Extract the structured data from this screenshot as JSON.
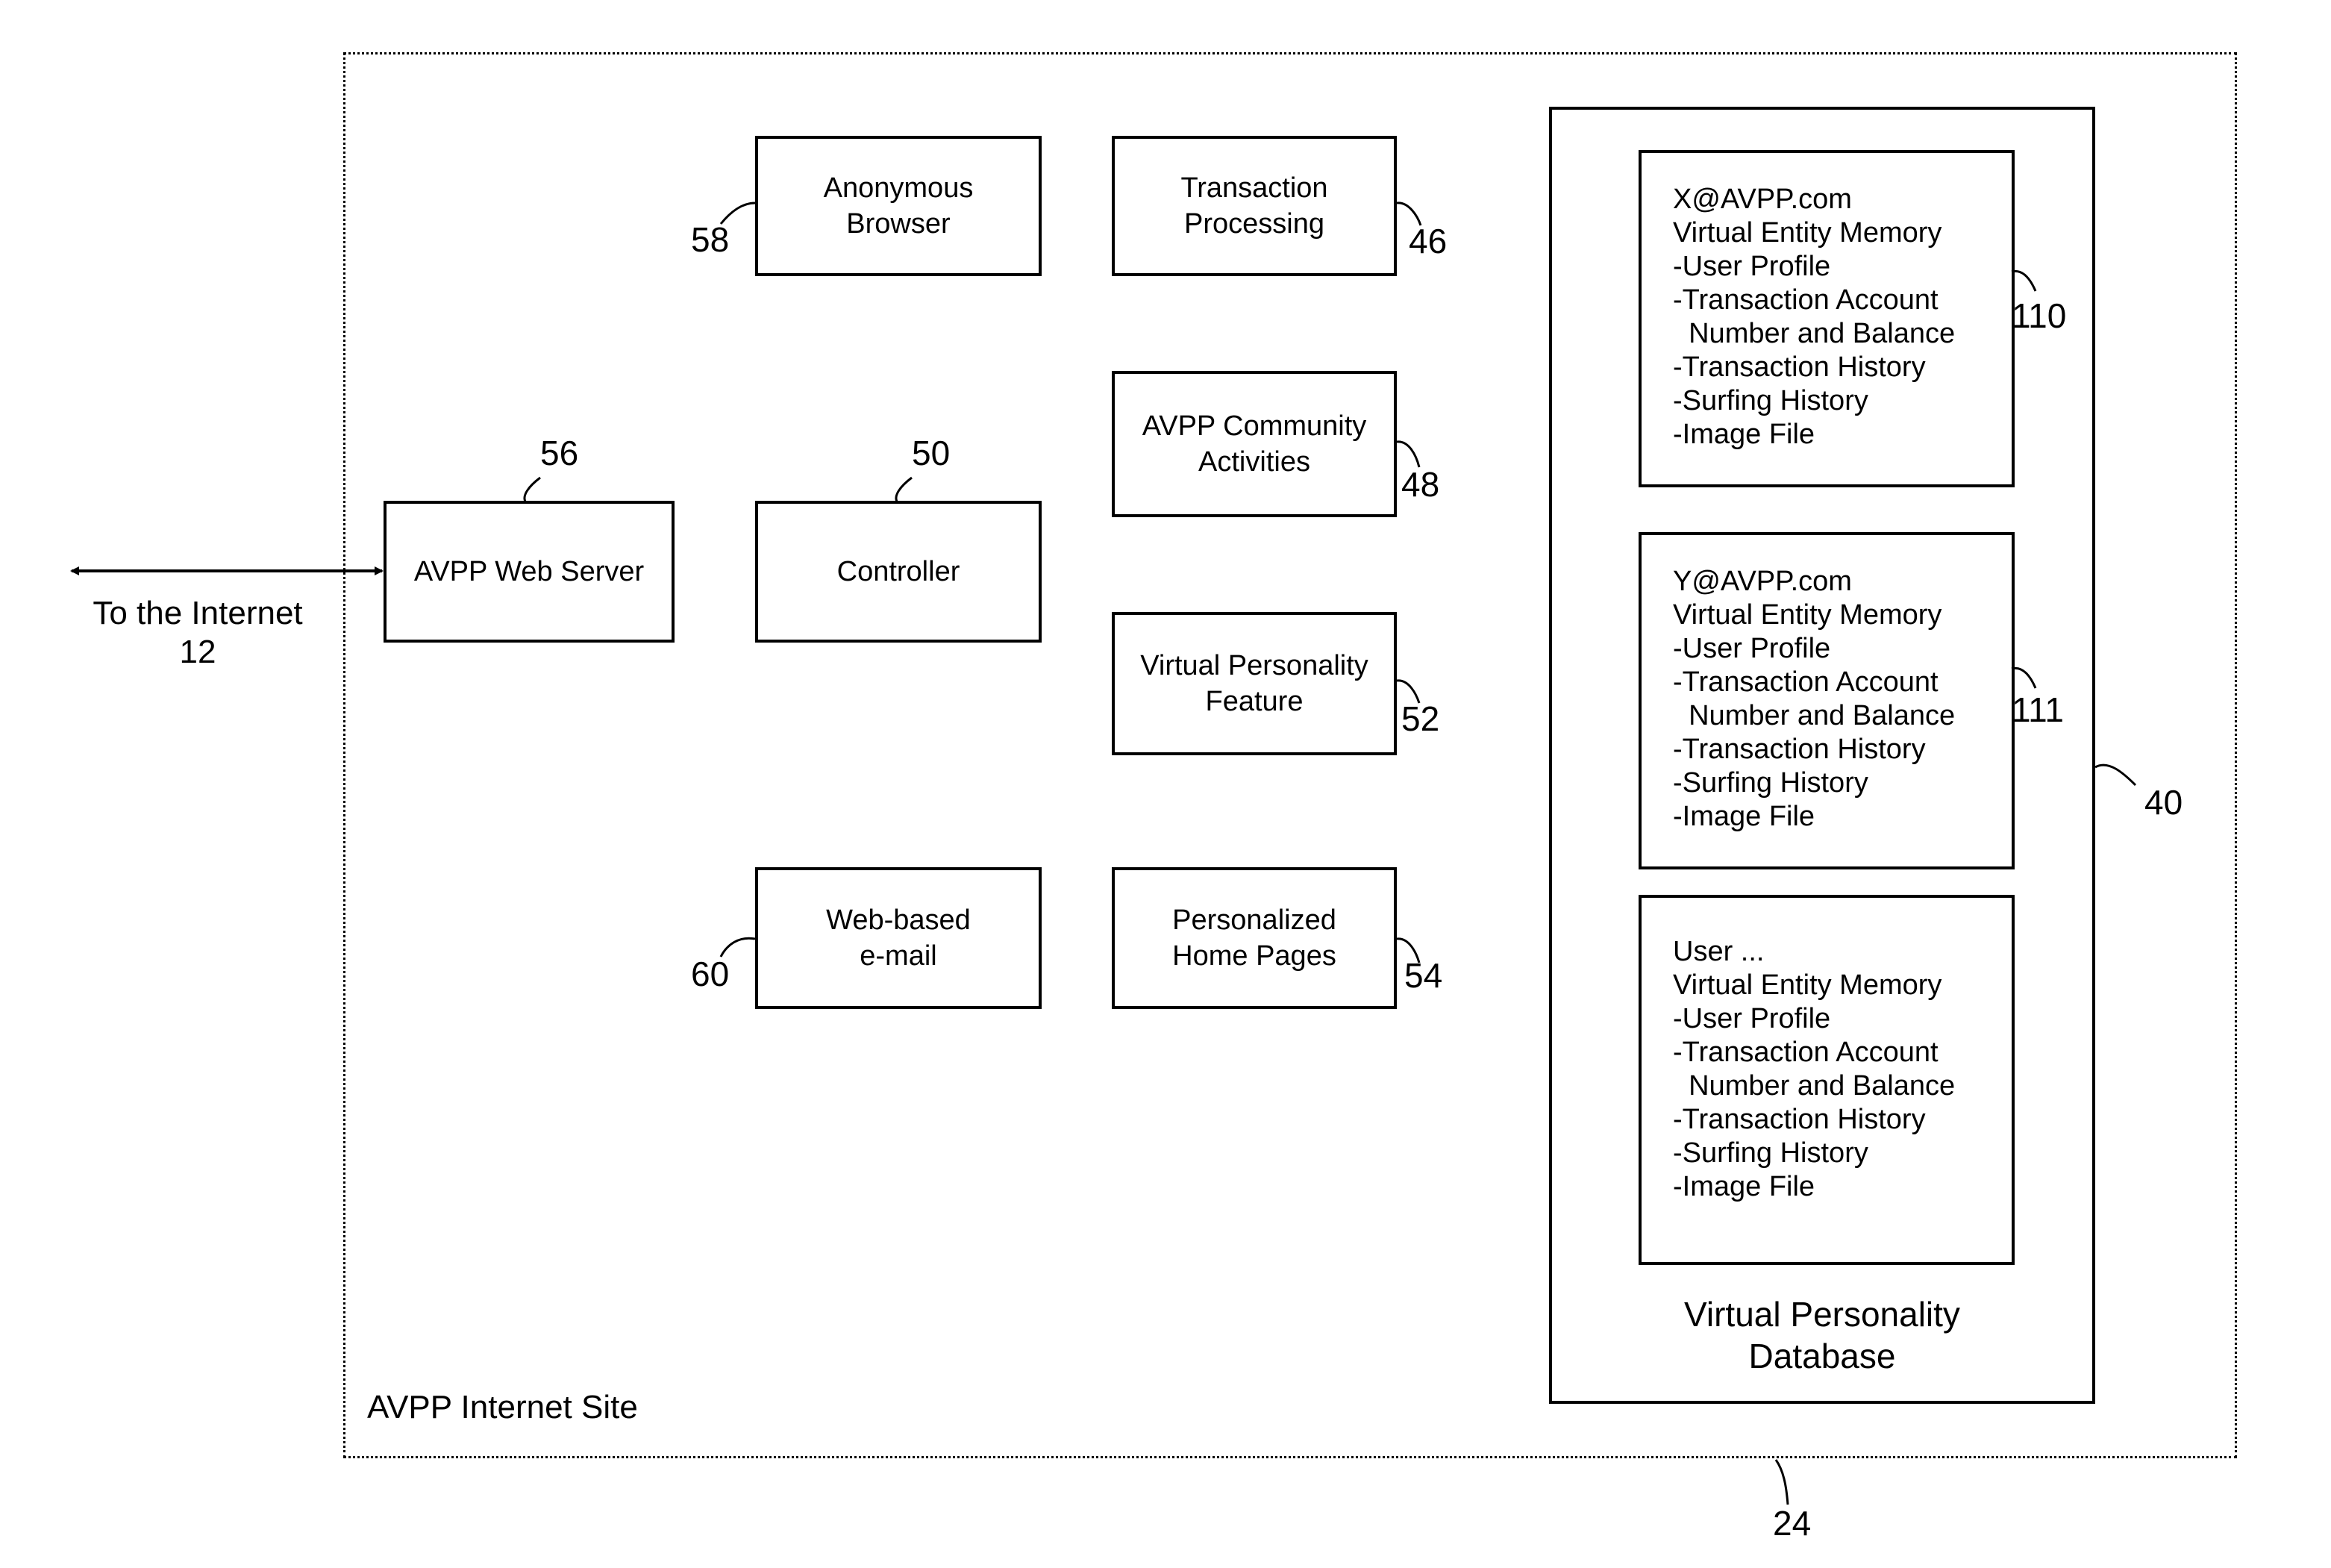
{
  "site": {
    "title": "AVPP Internet Site",
    "ref": "24"
  },
  "internet": {
    "label": "To the Internet",
    "ref": "12"
  },
  "web_server": {
    "label": "AVPP Web Server",
    "ref": "56"
  },
  "controller": {
    "label": "Controller",
    "ref": "50"
  },
  "anonymous_browser": {
    "label": "Anonymous\nBrowser",
    "ref": "58"
  },
  "web_email": {
    "label": "Web-based\ne-mail",
    "ref": "60"
  },
  "transaction_processing": {
    "label": "Transaction\nProcessing",
    "ref": "46"
  },
  "community": {
    "label": "AVPP Community\nActivities",
    "ref": "48"
  },
  "vp_feature": {
    "label": "Virtual Personality\nFeature",
    "ref": "52"
  },
  "home_pages": {
    "label": "Personalized\nHome Pages",
    "ref": "54"
  },
  "database": {
    "caption_line1": "Virtual Personality",
    "caption_line2": "Database",
    "ref": "40",
    "entries": [
      {
        "ref": "110",
        "lines": [
          "X@AVPP.com",
          "Virtual Entity Memory",
          "-User Profile",
          "-Transaction Account",
          "  Number and Balance",
          "-Transaction History",
          "-Surfing History",
          "-Image File"
        ]
      },
      {
        "ref": "111",
        "lines": [
          "Y@AVPP.com",
          "Virtual Entity Memory",
          "-User Profile",
          "-Transaction Account",
          "  Number and Balance",
          "-Transaction History",
          "-Surfing History",
          "-Image File"
        ]
      },
      {
        "ref": "",
        "lines": [
          "User ...",
          "Virtual Entity Memory",
          "-User Profile",
          "-Transaction Account",
          "  Number and Balance",
          "-Transaction History",
          "-Surfing History",
          "-Image File"
        ]
      }
    ]
  }
}
